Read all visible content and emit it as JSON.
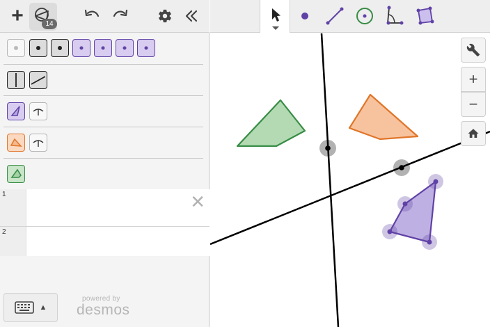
{
  "toolbar": {
    "add_icon": "plus-icon",
    "shapes_icon": "shapes-icon",
    "shapes_count": "14",
    "undo_icon": "undo-icon",
    "redo_icon": "redo-icon",
    "settings_icon": "gear-icon",
    "collapse_icon": "double-chevron-left-icon"
  },
  "tools": [
    "pointer",
    "point",
    "segment",
    "circle",
    "angle",
    "polygon"
  ],
  "style_rows": [
    {
      "kind": "point-style",
      "buttons": [
        "hidden-point",
        "filled-point",
        "filled-point",
        "purple-point",
        "purple-point",
        "purple-point",
        "purple-point"
      ]
    },
    {
      "kind": "line-style",
      "buttons": [
        "split-box",
        "diagonal-box"
      ]
    },
    {
      "kind": "purple-shape",
      "buttons": [
        "purple-triangle",
        "angle-mark"
      ]
    },
    {
      "kind": "orange-shape",
      "buttons": [
        "orange-triangle",
        "angle-mark"
      ]
    },
    {
      "kind": "green-shape",
      "buttons": [
        "green-triangle"
      ]
    }
  ],
  "expressions": [
    {
      "index": "1",
      "delete_symbol": "✕"
    },
    {
      "index": "2"
    }
  ],
  "keyboard": {
    "icon": "keyboard-icon",
    "arrow": "▲"
  },
  "branding": {
    "powered_by": "powered by",
    "name": "desmos"
  },
  "graph_controls": {
    "wrench": "wrench-icon",
    "zoom_in": "+",
    "zoom_out": "−",
    "home": "home-icon"
  },
  "colors": {
    "green": "#388c46",
    "orange": "#e0762a",
    "purple": "#6042a6",
    "black": "#000000"
  }
}
